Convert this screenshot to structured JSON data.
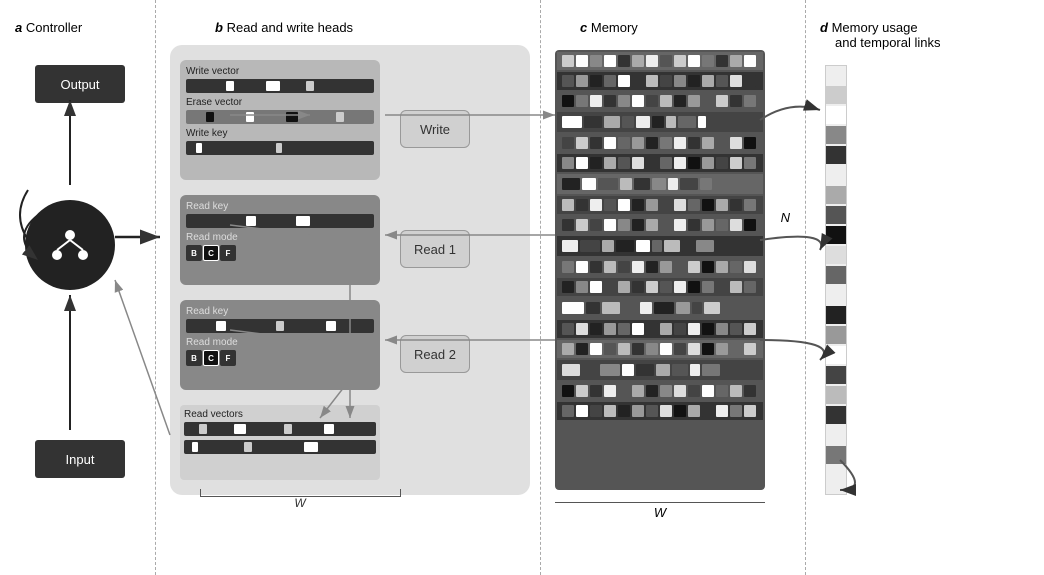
{
  "sections": {
    "a": {
      "letter": "a",
      "label": "Controller"
    },
    "b": {
      "letter": "b",
      "label": "Read and write heads"
    },
    "c": {
      "letter": "c",
      "label": "Memory"
    },
    "d": {
      "letter": "d",
      "label": "Memory usage and temporal links"
    }
  },
  "controller": {
    "output_label": "Output",
    "input_label": "Input"
  },
  "rw_heads": {
    "write_vector_label": "Write vector",
    "erase_vector_label": "Erase vector",
    "write_key_label": "Write key",
    "read_key_label1": "Read key",
    "read_mode_label1": "Read mode",
    "read_key_label2": "Read key",
    "read_mode_label2": "Read mode",
    "read_vectors_label": "Read vectors",
    "write_op_label": "Write",
    "read1_op_label": "Read 1",
    "read2_op_label": "Read 2",
    "mode_badges": [
      "B",
      "C",
      "F"
    ],
    "w_label": "W"
  },
  "memory": {
    "w_label": "W",
    "n_label": "N"
  },
  "memusage": {
    "label_part1": "Memory usage",
    "label_part2": "and temporal links"
  }
}
